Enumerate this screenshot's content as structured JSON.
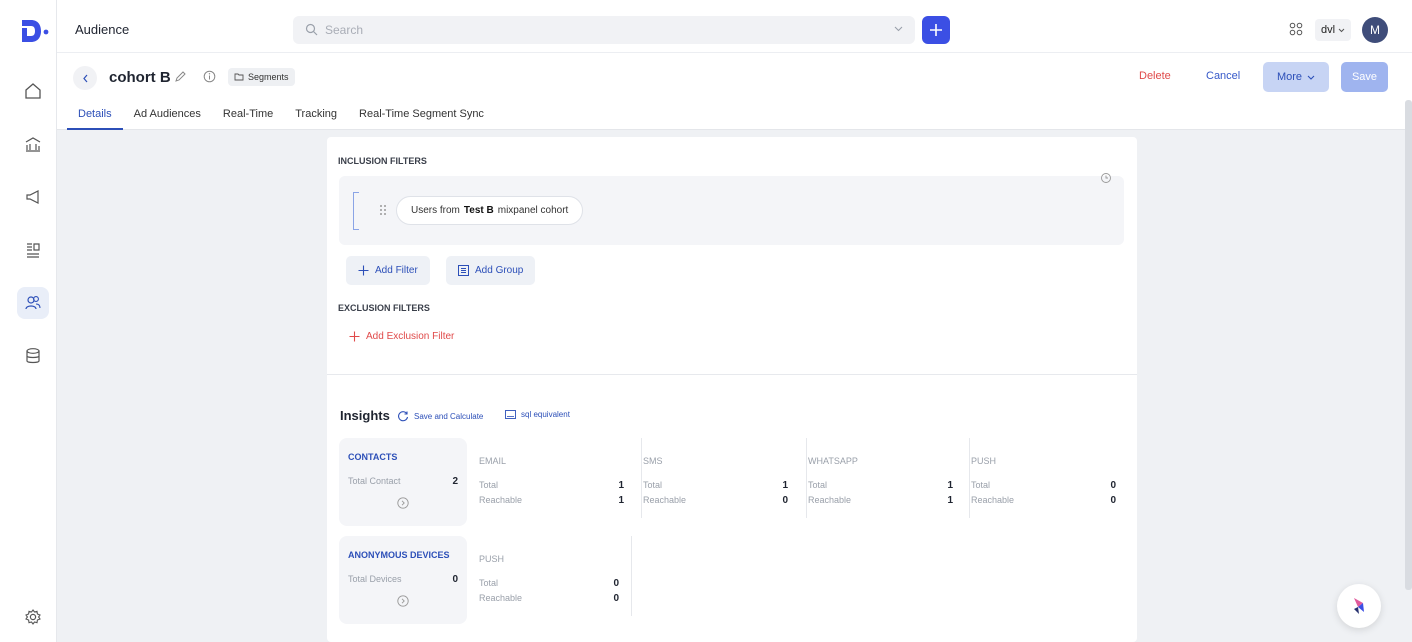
{
  "topbar": {
    "title": "Audience",
    "search_placeholder": "Search",
    "workspace": "dvl",
    "avatar_initial": "M"
  },
  "segment": {
    "name": "cohort B",
    "chip": "Segments",
    "actions": {
      "delete": "Delete",
      "cancel": "Cancel",
      "more": "More",
      "save": "Save"
    },
    "tabs": [
      "Details",
      "Ad Audiences",
      "Real-Time",
      "Tracking",
      "Real-Time Segment Sync"
    ],
    "active_tab": "Details"
  },
  "filters": {
    "inclusion_label": "INCLUSION FILTERS",
    "rule": {
      "prefix": "Users from",
      "name": "Test B",
      "suffix": "mixpanel cohort"
    },
    "add_filter": "Add Filter",
    "add_group": "Add Group",
    "exclusion_label": "EXCLUSION FILTERS",
    "add_exclusion": "Add Exclusion Filter"
  },
  "insights": {
    "title": "Insights",
    "save_calc": "Save and Calculate",
    "sql": "sql equivalent",
    "contacts": {
      "label": "CONTACTS",
      "total_label": "Total Contact",
      "total": "2",
      "channels": [
        {
          "name": "EMAIL",
          "total_label": "Total",
          "total": "1",
          "reach_label": "Reachable",
          "reachable": "1"
        },
        {
          "name": "SMS",
          "total_label": "Total",
          "total": "1",
          "reach_label": "Reachable",
          "reachable": "0"
        },
        {
          "name": "WHATSAPP",
          "total_label": "Total",
          "total": "1",
          "reach_label": "Reachable",
          "reachable": "1"
        },
        {
          "name": "PUSH",
          "total_label": "Total",
          "total": "0",
          "reach_label": "Reachable",
          "reachable": "0"
        }
      ]
    },
    "devices": {
      "label": "ANONYMOUS DEVICES",
      "total_label": "Total Devices",
      "total": "0",
      "channels": [
        {
          "name": "PUSH",
          "total_label": "Total",
          "total": "0",
          "reach_label": "Reachable",
          "reachable": "0"
        }
      ]
    }
  },
  "colors": {
    "accent": "#3b4fe4",
    "link": "#2c4fb8",
    "danger": "#e04a4a"
  }
}
